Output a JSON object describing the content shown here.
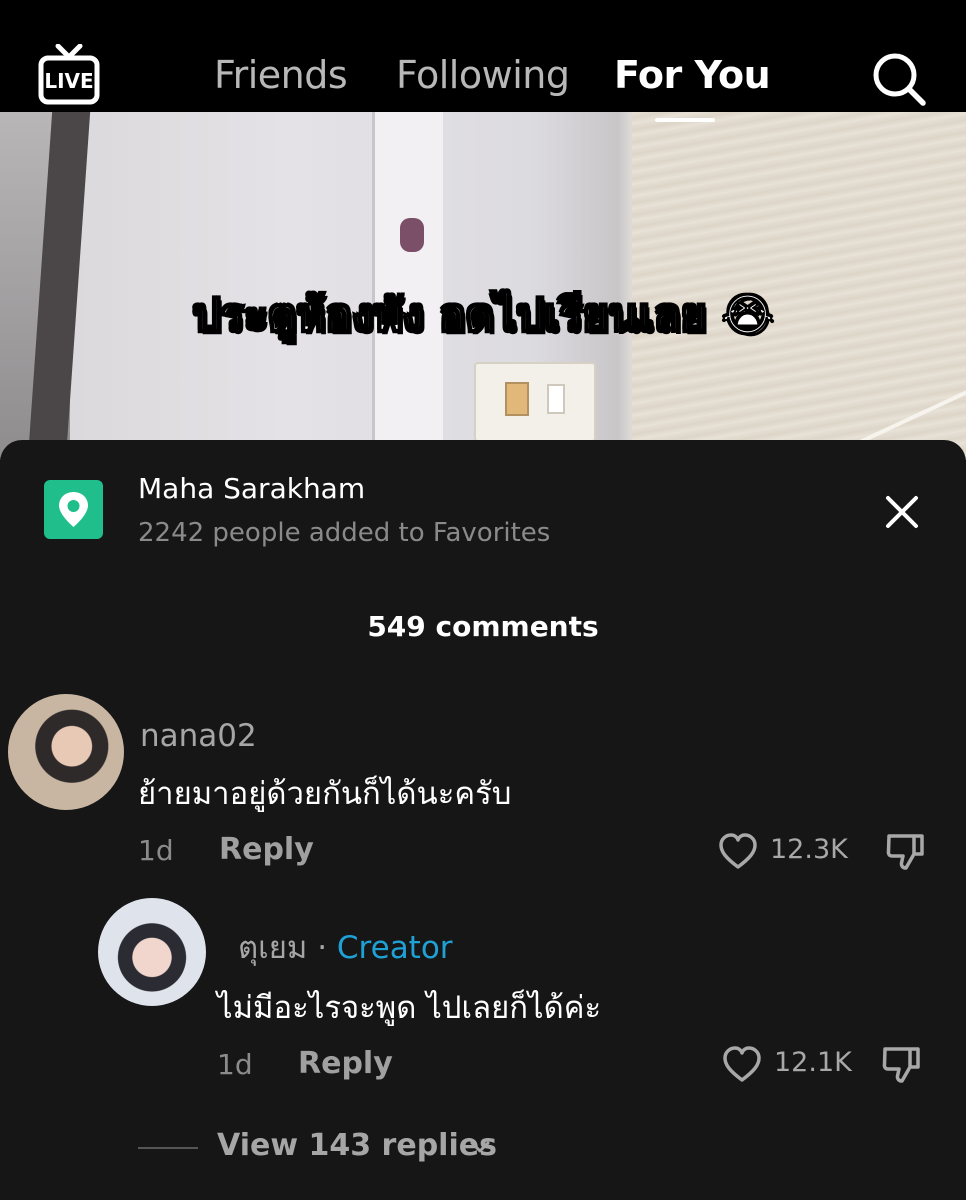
{
  "topbar": {
    "live_label": "LIVE",
    "tabs": [
      {
        "label": "Friends"
      },
      {
        "label": "Following"
      },
      {
        "label": "For You"
      }
    ]
  },
  "video": {
    "caption": "ประตูห้องพัง อดไปเรียนเลย 😭"
  },
  "sheet": {
    "place_name": "Maha Sarakham",
    "favorites_text": "2242 people added to Favorites",
    "comment_count": "549 comments",
    "comments": [
      {
        "username": "nana02",
        "text": "ย้ายมาอยู่ด้วยกันก็ได้นะครับ",
        "time": "1d",
        "reply_label": "Reply",
        "likes": "12.3K"
      },
      {
        "username": "ตุเยม",
        "separator": "·",
        "badge": "Creator",
        "text": "ไม่มีอะไรจะพูด ไปเลยก็ได้ค่ะ",
        "time": "1d",
        "reply_label": "Reply",
        "likes": "12.1K"
      }
    ],
    "view_replies": "View 143 replies"
  },
  "colors": {
    "accent_green": "#1fbe8b",
    "creator_blue": "#1fa1d6",
    "sheet_bg": "#161616"
  }
}
